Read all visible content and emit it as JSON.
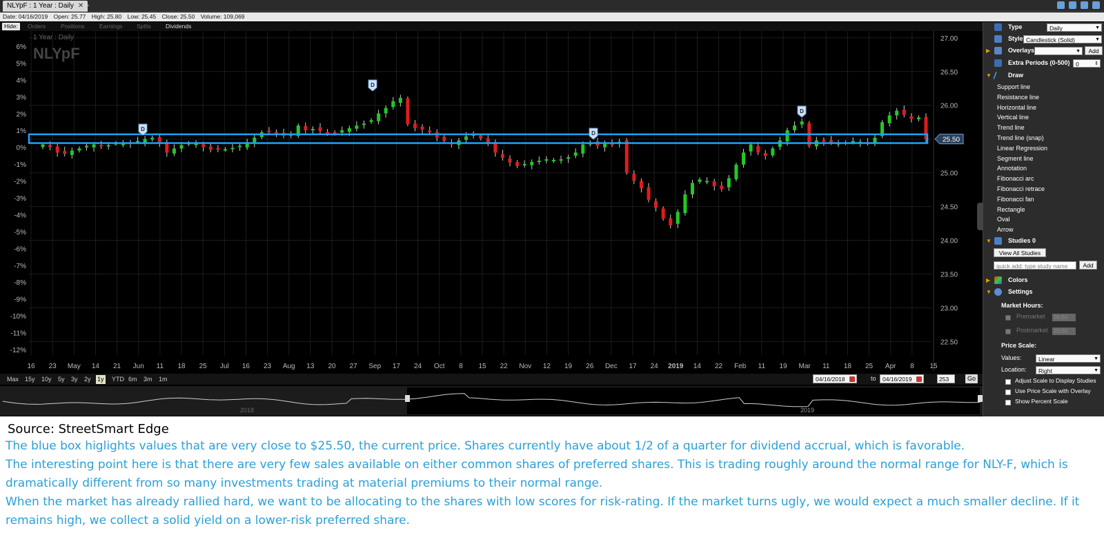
{
  "tab": {
    "label": "NLYpF : 1 Year : Daily",
    "close": "✕",
    "add": "+"
  },
  "ohlc": {
    "date": "Date: 04/16/2019",
    "open": "Open: 25.77",
    "high": "High: 25.80",
    "low": "Low: 25.45",
    "close": "Close: 25.50",
    "volume": "Volume: 109,069"
  },
  "hidebar": {
    "hide": "Hide:",
    "options": [
      "Orders",
      "Positions",
      "Earnings",
      "Splits",
      "Dividends"
    ]
  },
  "chart_data": {
    "type": "candlestick",
    "symbol": "NLYpF",
    "period_label": "1 Year : Daily",
    "y_right_ticks": [
      "27.00",
      "26.50",
      "26.00",
      "25.50",
      "25.00",
      "24.50",
      "24.00",
      "23.50",
      "23.00",
      "22.50"
    ],
    "y_left_ticks": [
      "6%",
      "5%",
      "4%",
      "3%",
      "2%",
      "1%",
      "0%",
      "-1%",
      "-2%",
      "-3%",
      "-4%",
      "-5%",
      "-6%",
      "-7%",
      "-8%",
      "-9%",
      "-10%",
      "-11%",
      "-12%"
    ],
    "x_ticks": [
      "16",
      "23",
      "May",
      "14",
      "21",
      "Jun",
      "11",
      "18",
      "25",
      "Jul",
      "16",
      "23",
      "Aug",
      "13",
      "20",
      "27",
      "Sep",
      "17",
      "24",
      "Oct",
      "8",
      "15",
      "22",
      "Nov",
      "12",
      "19",
      "26",
      "Dec",
      "17",
      "24",
      "2019",
      "14",
      "22",
      "Feb",
      "11",
      "19",
      "Mar",
      "11",
      "18",
      "25",
      "Apr",
      "8",
      "15"
    ],
    "ylim": [
      22.3,
      27.1
    ],
    "current_price_label": "25.50",
    "highlight_band": [
      25.44,
      25.57
    ],
    "closes": [
      25.42,
      25.38,
      25.3,
      25.28,
      25.33,
      25.36,
      25.4,
      25.42,
      25.39,
      25.41,
      25.44,
      25.43,
      25.45,
      25.47,
      25.5,
      25.52,
      25.43,
      25.3,
      25.36,
      25.41,
      25.44,
      25.43,
      25.38,
      25.34,
      25.36,
      25.35,
      25.37,
      25.4,
      25.44,
      25.52,
      25.6,
      25.62,
      25.59,
      25.55,
      25.57,
      25.7,
      25.63,
      25.65,
      25.62,
      25.6,
      25.58,
      25.63,
      25.66,
      25.7,
      25.73,
      25.78,
      25.88,
      25.96,
      26.06,
      26.11,
      25.72,
      25.66,
      25.64,
      25.6,
      25.52,
      25.47,
      25.42,
      25.48,
      25.54,
      25.57,
      25.51,
      25.44,
      25.3,
      25.22,
      25.15,
      25.1,
      25.13,
      25.16,
      25.18,
      25.2,
      25.19,
      25.2,
      25.23,
      25.3,
      25.42,
      25.45,
      25.4,
      25.44,
      25.42,
      25.46,
      25.0,
      24.88,
      24.77,
      24.6,
      24.48,
      24.32,
      24.22,
      24.42,
      24.68,
      24.85,
      24.9,
      24.88,
      24.8,
      24.76,
      24.92,
      25.12,
      25.3,
      25.42,
      25.3,
      25.25,
      25.36,
      25.48,
      25.63,
      25.7,
      25.76,
      25.4,
      25.48,
      25.46,
      25.45,
      25.44,
      25.45,
      25.47,
      25.46,
      25.44,
      25.52,
      25.75,
      25.85,
      25.92,
      25.86,
      25.8,
      25.82,
      25.5
    ]
  },
  "rangebar": {
    "buttons": [
      "Max",
      "15y",
      "10y",
      "5y",
      "3y",
      "2y",
      "1y",
      "YTD",
      "6m",
      "3m",
      "1m"
    ],
    "selected": "1y",
    "from": "04/16/2018",
    "to_label": "to",
    "to": "04/16/2019",
    "periods": "253",
    "go": "Go"
  },
  "navigator": {
    "year1": "2018",
    "year2": "2019"
  },
  "panel": {
    "type_label": "Type",
    "type_value": "Daily",
    "style_label": "Style",
    "style_value": "Candlestick (Solid)",
    "overlays_label": "Overlays",
    "overlays_add": "Add",
    "extra_label": "Extra Periods (0-500)",
    "extra_value": "0",
    "draw_label": "Draw",
    "draw_tools": [
      "Support line",
      "Resistance line",
      "Horizontal line",
      "Vertical line",
      "Trend line",
      "Trend line (snap)",
      "Linear Regression",
      "Segment line",
      "Annotation",
      "Fibonacci arc",
      "Fibonacci retrace",
      "Fibonacci fan",
      "Rectangle",
      "Oval",
      "Arrow"
    ],
    "studies_label": "Studies 0",
    "view_all": "View All Studies",
    "quick_add_placeholder": "quick add: type study name",
    "studies_add": "Add",
    "colors_label": "Colors",
    "settings_label": "Settings",
    "market_hours": "Market Hours:",
    "premarket": "Premarket",
    "premarket_time": "06:00",
    "postmarket": "Postmarket",
    "postmarket_time": "20:00",
    "price_scale": "Price Scale:",
    "values_label": "Values:",
    "values_value": "Linear",
    "location_label": "Location:",
    "location_value": "Right",
    "opt1": "Adjust Scale to Display Studies",
    "opt2": "Use Price Scale with Overlay",
    "opt3": "Show Percent Scale"
  },
  "caption": {
    "source": "Source: StreetSmart Edge",
    "p1": "The blue box higlights values that are very close to $25.50, the current price. Shares currently have about 1/2 of a quarter for dividend accrual, which is favorable.",
    "p2": "The interesting point here is that there are very few sales available on either common shares of preferred shares. This is trading roughly around the normal range for NLY-F, which is dramatically different from so many investments trading at material premiums to their normal range.",
    "p3": "When the market has already rallied hard, we want to be allocating to the shares with low scores for risk-rating. If the market turns ugly, we would expect a much smaller decline. If it remains high, we collect a solid yield on a lower-risk preferred share."
  }
}
